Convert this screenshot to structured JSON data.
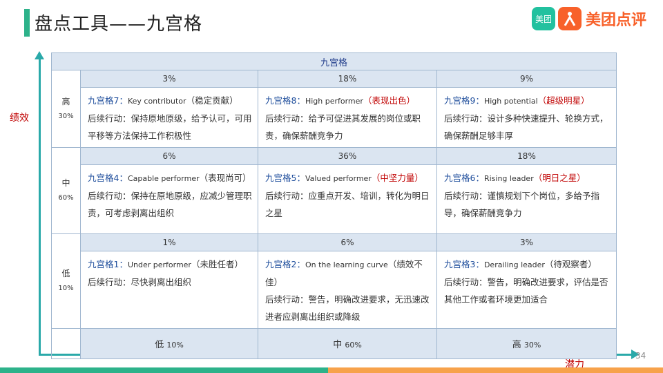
{
  "title": "盘点工具——九宫格",
  "logo": {
    "badge": "美团",
    "text": "美团点评"
  },
  "axes": {
    "y_label": "绩效",
    "x_label": "潜力"
  },
  "page_number": "34",
  "grid": {
    "title": "九宫格",
    "rows": [
      {
        "level": "高",
        "level_pct": "30%",
        "cells": [
          {
            "pct": "3%",
            "name": "九宫格7：",
            "en": "Key contributor",
            "tag": "（稳定贡献）",
            "action": "后续行动：保持原地原级，给予认可，可用平移等方法保持工作积极性"
          },
          {
            "pct": "18%",
            "name": "九宫格8：",
            "en": "High performer",
            "tag": "（表现出色）",
            "action": "后续行动：给予可促进其发展的岗位或职责，确保薪酬竞争力"
          },
          {
            "pct": "9%",
            "name": "九宫格9：",
            "en": "High potential",
            "tag": "（超级明星）",
            "action": "后续行动：设计多种快速提升、轮换方式，确保薪酬足够丰厚"
          }
        ]
      },
      {
        "level": "中",
        "level_pct": "60%",
        "cells": [
          {
            "pct": "6%",
            "name": "九宫格4：",
            "en": "Capable performer",
            "tag": "（表现尚可）",
            "action": "后续行动：保持在原地原级，应减少管理职责，可考虑剥离出组织"
          },
          {
            "pct": "36%",
            "name": "九宫格5：",
            "en": "Valued performer",
            "tag": "（中坚力量）",
            "action": "后续行动：应重点开发、培训，转化为明日之星"
          },
          {
            "pct": "18%",
            "name": "九宫格6：",
            "en": "Rising leader",
            "tag": "（明日之星）",
            "action": "后续行动：谨慎规划下个岗位，多给予指导，确保薪酬竞争力"
          }
        ]
      },
      {
        "level": "低",
        "level_pct": "10%",
        "cells": [
          {
            "pct": "1%",
            "name": "九宫格1：",
            "en": "Under performer",
            "tag": "（未胜任者）",
            "action": "后续行动：尽快剥离出组织"
          },
          {
            "pct": "6%",
            "name": "九宫格2：",
            "en": "On the learning curve",
            "tag": "（绩效不佳）",
            "action": "后续行动：警告，明确改进要求，无迅速改进者应剥离出组织或降级"
          },
          {
            "pct": "3%",
            "name": "九宫格3：",
            "en": "Derailing leader",
            "tag": "（待观察者）",
            "action": "后续行动：警告，明确改进要求，评估是否其他工作或者环境更加适合"
          }
        ]
      }
    ],
    "bottom": [
      {
        "level": "低",
        "pct": "10%"
      },
      {
        "level": "中",
        "pct": "60%"
      },
      {
        "level": "高",
        "pct": "30%"
      }
    ]
  }
}
